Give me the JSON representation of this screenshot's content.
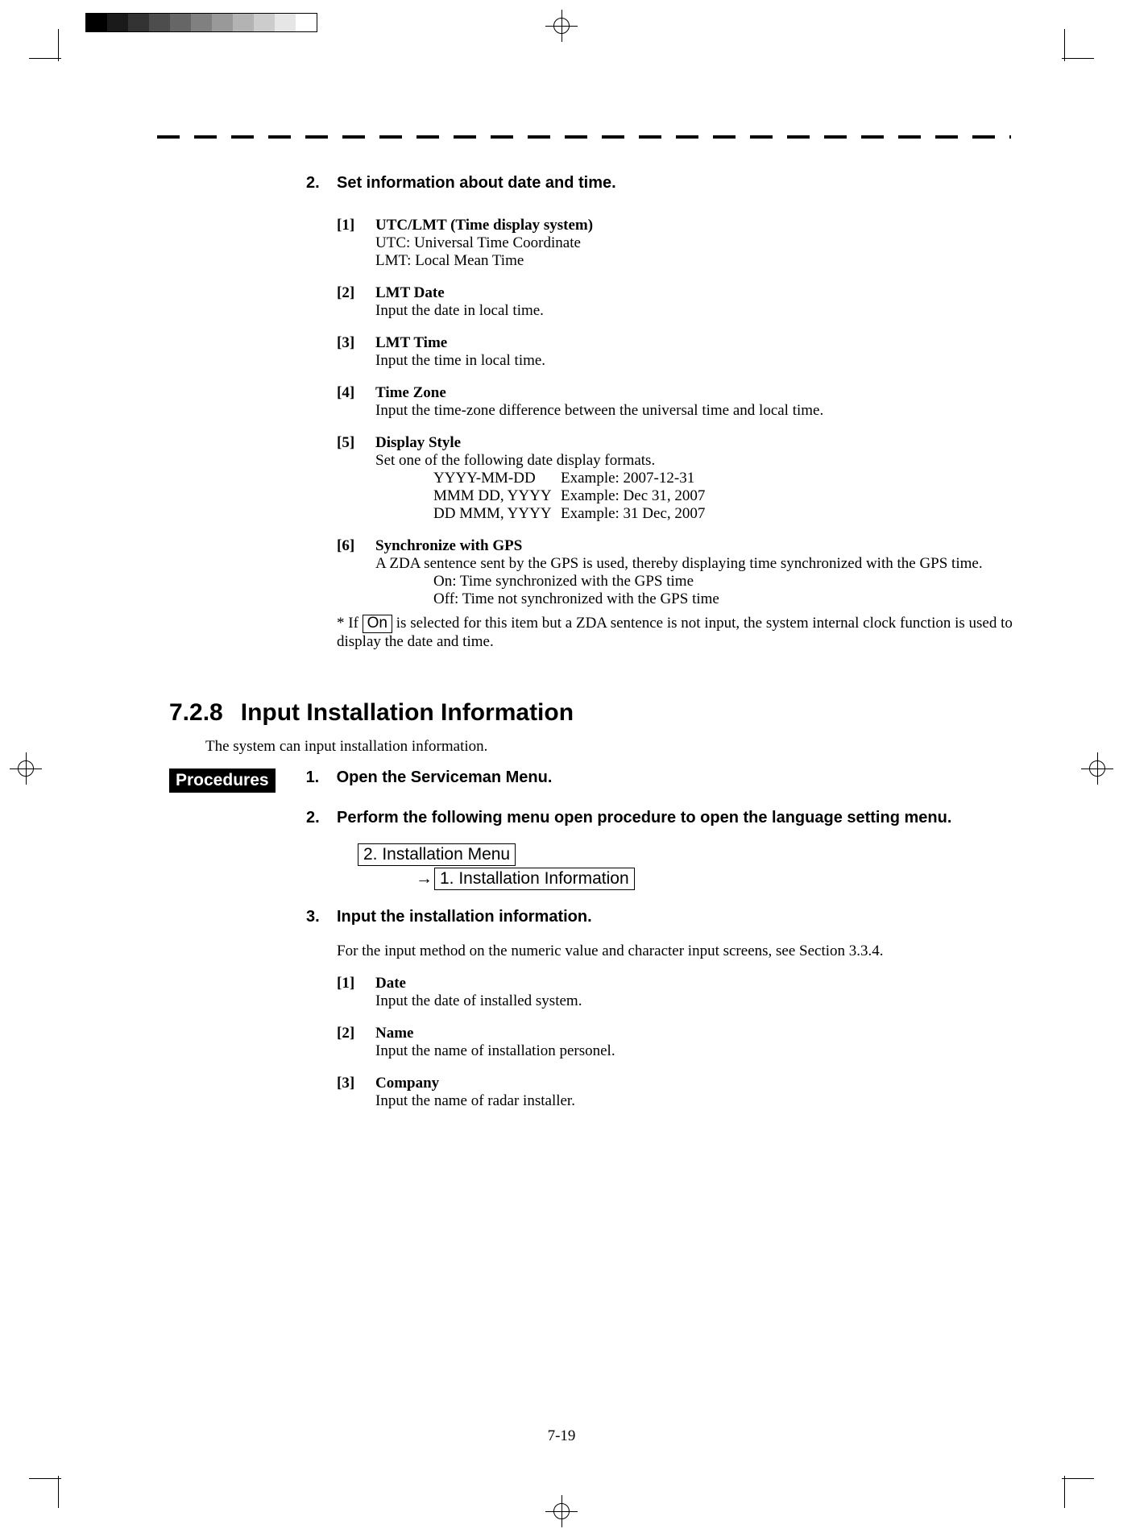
{
  "step2": {
    "num": "2.",
    "title": "Set information about date and time."
  },
  "items_a": [
    {
      "num": "[1]",
      "title": "UTC/LMT (Time display system)",
      "lines": [
        "UTC: Universal Time Coordinate",
        "LMT: Local Mean Time"
      ]
    },
    {
      "num": "[2]",
      "title": "LMT Date",
      "lines": [
        "Input the date in local time."
      ]
    },
    {
      "num": "[3]",
      "title": "LMT Time",
      "lines": [
        "Input the time in local time."
      ]
    },
    {
      "num": "[4]",
      "title": "Time Zone",
      "lines": [
        "Input the time-zone difference between the universal time and local time."
      ]
    }
  ],
  "item5": {
    "num": "[5]",
    "title": "Display Style",
    "intro": "Set one of the following date display formats.",
    "formats": [
      {
        "fmt": "YYYY-MM-DD",
        "ex": "Example: 2007-12-31"
      },
      {
        "fmt": "MMM DD, YYYY",
        "ex": "Example: Dec 31, 2007"
      },
      {
        "fmt": "DD MMM, YYYY",
        "ex": "Example: 31 Dec, 2007"
      }
    ]
  },
  "item6": {
    "num": "[6]",
    "title": "Synchronize with GPS",
    "desc": "A ZDA sentence sent by the GPS is used, thereby displaying time synchronized with the GPS time.",
    "on": "On: Time synchronized with the GPS time",
    "off": "Off: Time not synchronized with the GPS time"
  },
  "note": {
    "prefix": "* If ",
    "boxed": "On",
    "mid": " is selected for this item but a ZDA sentence is not input, the system internal clock function is used to display the date and time."
  },
  "section": {
    "num": "7.2.8",
    "title": "Input Installation Information",
    "intro": "The system can input installation information."
  },
  "procedures_label": "Procedures",
  "proc_step1": {
    "num": "1.",
    "title": "Open the Serviceman Menu."
  },
  "proc_step2": {
    "num": "2.",
    "title": "Perform the following menu open procedure to open the language setting menu."
  },
  "menu": {
    "item1": "2. Installation Menu",
    "arrow": "→",
    "item2": "1. Installation Information"
  },
  "proc_step3": {
    "num": "3.",
    "title": "Input the installation information."
  },
  "input_note": "For the input method on the numeric value and character input screens, see Section 3.3.4.",
  "items_b": [
    {
      "num": "[1]",
      "title": "Date",
      "lines": [
        "Input the date of installed system."
      ]
    },
    {
      "num": "[2]",
      "title": "Name",
      "lines": [
        "Input the name of installation personel."
      ]
    },
    {
      "num": "[3]",
      "title": "Company",
      "lines": [
        "Input the name of radar installer."
      ]
    }
  ],
  "page_number": "7-19"
}
